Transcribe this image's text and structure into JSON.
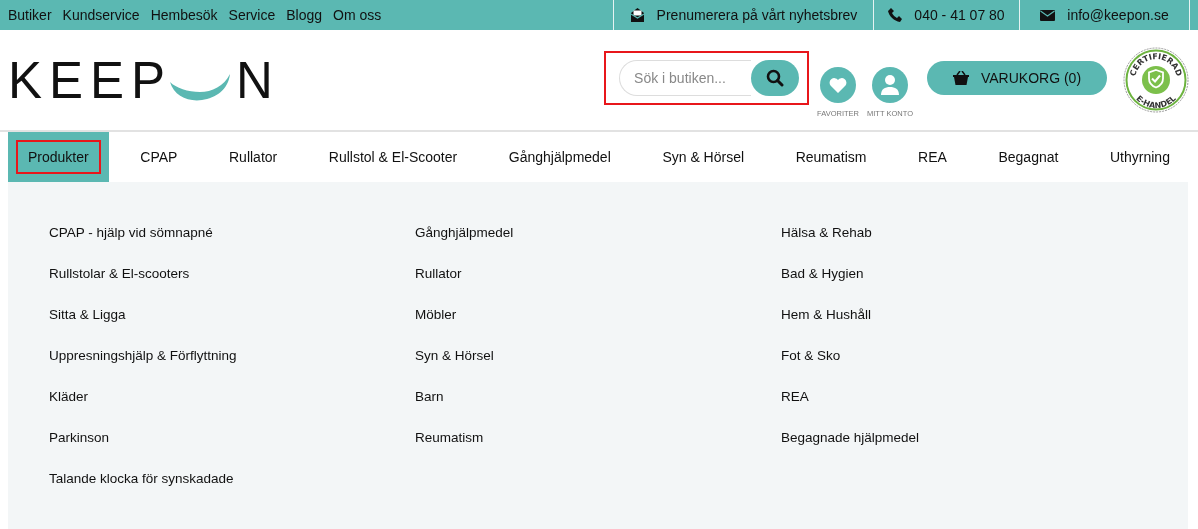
{
  "top_bar": {
    "links": [
      "Butiker",
      "Kundservice",
      "Hembesök",
      "Service",
      "Blogg",
      "Om oss"
    ],
    "contacts": [
      {
        "kind": "newsletter",
        "label": "Prenumerera på vårt nyhetsbrev"
      },
      {
        "kind": "phone",
        "label": "040 - 41 07 80"
      },
      {
        "kind": "mail",
        "label": "info@keepon.se"
      }
    ]
  },
  "logo": {
    "before": "KEEP",
    "after": "N"
  },
  "search": {
    "placeholder": "Sök i butiken..."
  },
  "header_actions": [
    {
      "kind": "heart",
      "label": "FAVORITER"
    },
    {
      "kind": "user",
      "label": "MITT KONTO"
    }
  ],
  "cart": {
    "label": "VARUKORG (0)"
  },
  "badge": {
    "top": "CERTIFIERAD",
    "bottom": "E-HANDEL"
  },
  "nav": [
    {
      "label": "Produkter",
      "selected": true
    },
    {
      "label": "CPAP",
      "selected": false
    },
    {
      "label": "Rullator",
      "selected": false
    },
    {
      "label": "Rullstol & El-Scooter",
      "selected": false
    },
    {
      "label": "Gånghjälpmedel",
      "selected": false
    },
    {
      "label": "Syn & Hörsel",
      "selected": false
    },
    {
      "label": "Reumatism",
      "selected": false
    },
    {
      "label": "REA",
      "selected": false
    },
    {
      "label": "Begagnat",
      "selected": false
    },
    {
      "label": "Uthyrning",
      "selected": false
    }
  ],
  "menu_columns": [
    [
      "CPAP - hjälp vid sömnapné",
      "Rullstolar & El-scooters",
      "Sitta & Ligga",
      "Uppresningshjälp & Förflyttning",
      "Kläder",
      "Parkinson",
      "Talande klocka för synskadade"
    ],
    [
      "Gånghjälpmedel",
      "Rullator",
      "Möbler",
      "Syn & Hörsel",
      "Barn",
      "Reumatism"
    ],
    [
      "Hälsa & Rehab",
      "Bad & Hygien",
      "Hem & Hushåll",
      "Fot & Sko",
      "REA",
      "Begagnade hjälpmedel"
    ]
  ]
}
